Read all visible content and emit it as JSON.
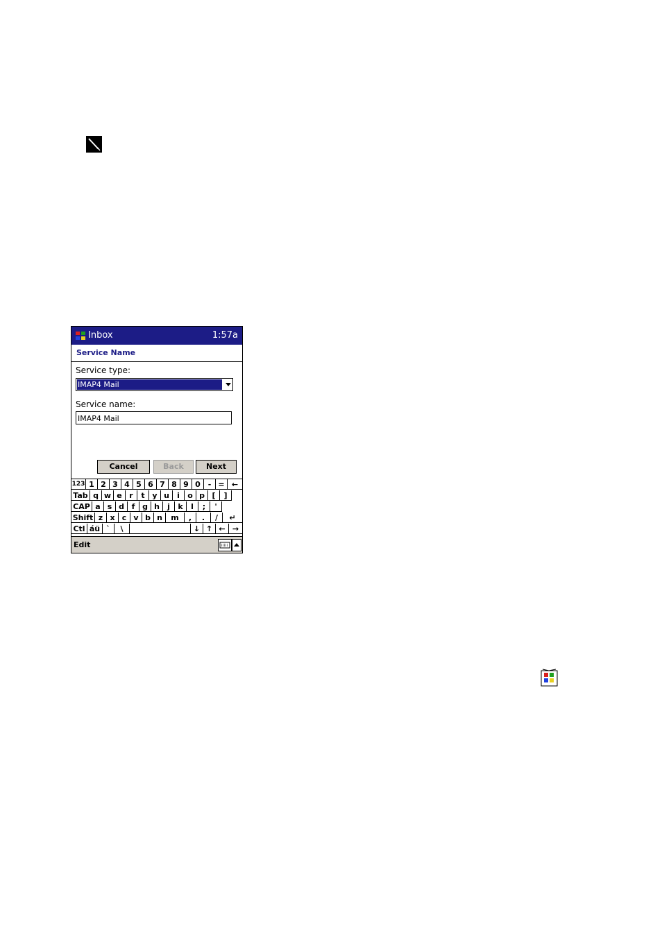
{
  "titlebar": {
    "app": "Inbox",
    "time": "1:57a"
  },
  "header": {
    "title": "Service Name"
  },
  "form": {
    "service_type_label": "Service type:",
    "service_type_value": "IMAP4 Mail",
    "service_name_label": "Service name:",
    "service_name_value": "IMAP4 Mail"
  },
  "buttons": {
    "cancel": "Cancel",
    "back": "Back",
    "next": "Next"
  },
  "keyboard": {
    "row1": [
      "123",
      "1",
      "2",
      "3",
      "4",
      "5",
      "6",
      "7",
      "8",
      "9",
      "0",
      "-",
      "=",
      "←"
    ],
    "row2": [
      "Tab",
      "q",
      "w",
      "e",
      "r",
      "t",
      "y",
      "u",
      "i",
      "o",
      "p",
      "[",
      "]"
    ],
    "row3": [
      "CAP",
      "a",
      "s",
      "d",
      "f",
      "g",
      "h",
      "j",
      "k",
      "l",
      ";",
      "'"
    ],
    "row4": [
      "Shift",
      "z",
      "x",
      "c",
      "v",
      "b",
      "n",
      "m",
      ",",
      ".",
      "/",
      "↵"
    ],
    "row5": [
      "Ctl",
      "áü",
      "`",
      "\\",
      "",
      "↓",
      "↑",
      "←",
      "→"
    ]
  },
  "menubar": {
    "edit": "Edit"
  },
  "colors": {
    "titlebar": "#1c1c86",
    "selection": "#1c1c86",
    "menubar": "#d4d0c8"
  },
  "icons": {
    "stylus": "stylus-icon",
    "app_logo": "windows-flag-icon",
    "keyboard": "keyboard-icon",
    "inbox": "inbox-icon"
  }
}
